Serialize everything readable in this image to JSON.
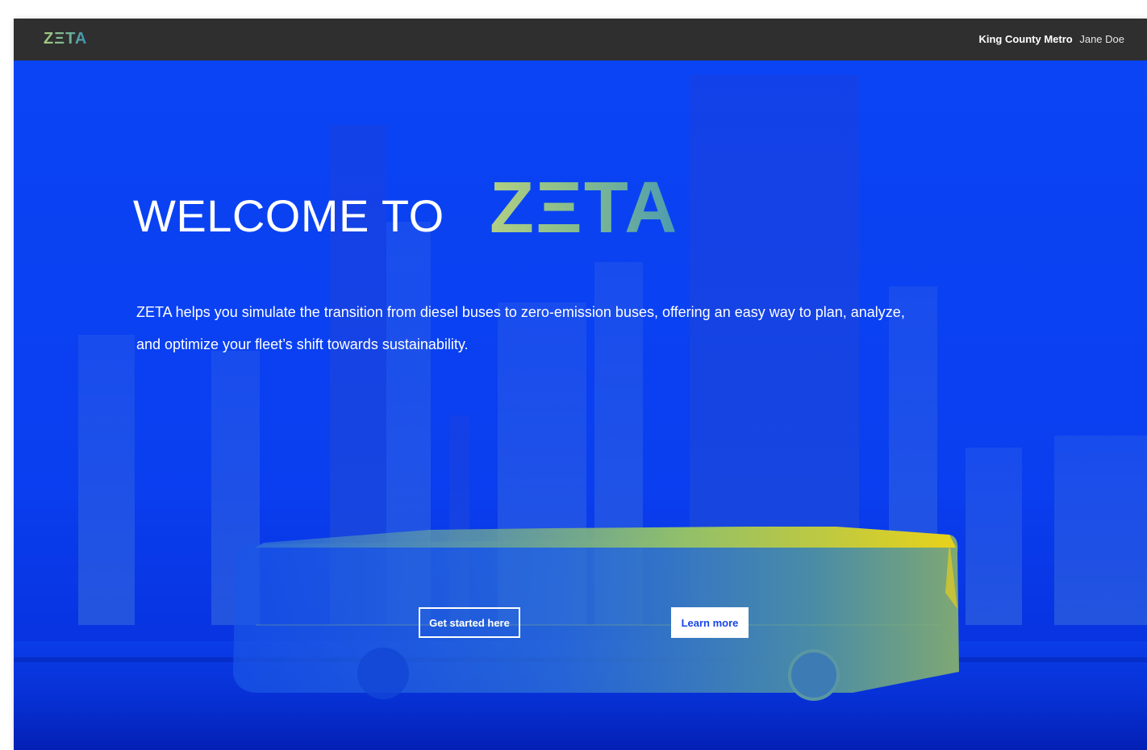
{
  "header": {
    "brand": "ZΞTA",
    "organization": "King County Metro",
    "user_name": "Jane Doe"
  },
  "hero": {
    "welcome": "WELCOME TO",
    "logo_text": "ZΞTA",
    "description": "ZETA helps you simulate the transition from diesel buses to zero-emission buses, offering an easy way to plan, analyze, and optimize your fleet’s shift towards sustainability.",
    "primary_cta": "Get started here",
    "secondary_cta": "Learn more"
  },
  "colors": {
    "topbar": "#2f2f2f",
    "hero_blue": "#0a3ff0",
    "logo_green": "#a6c97c",
    "logo_teal": "#3b8fb4",
    "bus_yellow": "#e8d21a"
  },
  "icons": {
    "background": "city-skyline-illustration",
    "vehicle": "bus-illustration"
  }
}
